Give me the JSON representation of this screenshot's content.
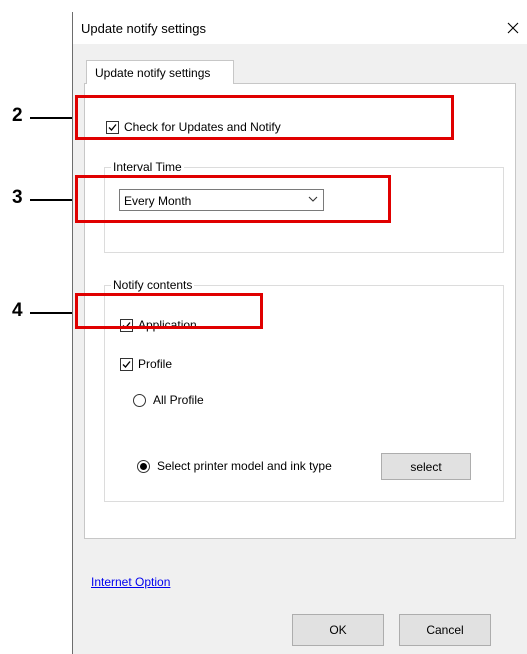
{
  "dialog": {
    "title": "Update notify settings",
    "close_icon": "close-icon",
    "tab_label": "Update notify settings",
    "check_updates": {
      "label": "Check for Updates and Notify",
      "checked": true
    },
    "interval": {
      "legend": "Interval Time",
      "selected": "Every Month"
    },
    "notify": {
      "legend": "Notify contents",
      "application": {
        "label": "Application",
        "checked": true
      },
      "profile": {
        "label": "Profile",
        "checked": true
      },
      "all_profile": {
        "label": "All Profile",
        "selected": false
      },
      "select_model": {
        "label": "Select printer model and ink type",
        "selected": true
      },
      "select_button": "select"
    },
    "internet_option_link": "Internet Option",
    "ok_button": "OK",
    "cancel_button": "Cancel"
  },
  "callouts": [
    "2",
    "3",
    "4"
  ],
  "colors": {
    "highlight": "#e00000",
    "link": "#0000ee"
  }
}
